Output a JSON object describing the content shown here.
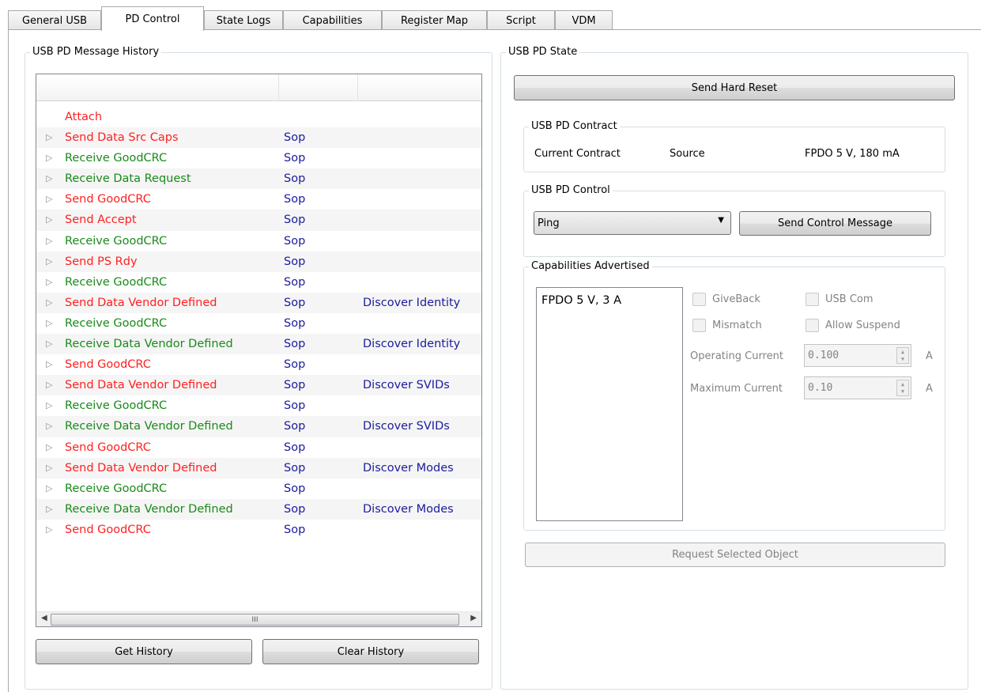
{
  "tabs": [
    "General USB",
    "PD Control",
    "State Logs",
    "Capabilities",
    "Register Map",
    "Script",
    "VDM"
  ],
  "active_tab": "PD Control",
  "history": {
    "title": "USB PD Message History",
    "rows": [
      {
        "msg": "Attach",
        "kind": "send",
        "sop": "",
        "vdm": "",
        "expandable": false
      },
      {
        "msg": "Send Data Src Caps",
        "kind": "send",
        "sop": "Sop",
        "vdm": "",
        "expandable": true
      },
      {
        "msg": "Receive GoodCRC",
        "kind": "recv",
        "sop": "Sop",
        "vdm": "",
        "expandable": true
      },
      {
        "msg": "Receive Data Request",
        "kind": "recv",
        "sop": "Sop",
        "vdm": "",
        "expandable": true
      },
      {
        "msg": "Send GoodCRC",
        "kind": "send",
        "sop": "Sop",
        "vdm": "",
        "expandable": true
      },
      {
        "msg": "Send Accept",
        "kind": "send",
        "sop": "Sop",
        "vdm": "",
        "expandable": true
      },
      {
        "msg": "Receive GoodCRC",
        "kind": "recv",
        "sop": "Sop",
        "vdm": "",
        "expandable": true
      },
      {
        "msg": "Send PS Rdy",
        "kind": "send",
        "sop": "Sop",
        "vdm": "",
        "expandable": true
      },
      {
        "msg": "Receive GoodCRC",
        "kind": "recv",
        "sop": "Sop",
        "vdm": "",
        "expandable": true
      },
      {
        "msg": "Send Data Vendor Defined",
        "kind": "send",
        "sop": "Sop",
        "vdm": "Discover Identity",
        "expandable": true
      },
      {
        "msg": "Receive GoodCRC",
        "kind": "recv",
        "sop": "Sop",
        "vdm": "",
        "expandable": true
      },
      {
        "msg": "Receive Data Vendor Defined",
        "kind": "recv",
        "sop": "Sop",
        "vdm": "Discover Identity",
        "expandable": true
      },
      {
        "msg": "Send GoodCRC",
        "kind": "send",
        "sop": "Sop",
        "vdm": "",
        "expandable": true
      },
      {
        "msg": "Send Data Vendor Defined",
        "kind": "send",
        "sop": "Sop",
        "vdm": "Discover SVIDs",
        "expandable": true
      },
      {
        "msg": "Receive GoodCRC",
        "kind": "recv",
        "sop": "Sop",
        "vdm": "",
        "expandable": true
      },
      {
        "msg": "Receive Data Vendor Defined",
        "kind": "recv",
        "sop": "Sop",
        "vdm": "Discover SVIDs",
        "expandable": true
      },
      {
        "msg": "Send GoodCRC",
        "kind": "send",
        "sop": "Sop",
        "vdm": "",
        "expandable": true
      },
      {
        "msg": "Send Data Vendor Defined",
        "kind": "send",
        "sop": "Sop",
        "vdm": "Discover Modes",
        "expandable": true
      },
      {
        "msg": "Receive GoodCRC",
        "kind": "recv",
        "sop": "Sop",
        "vdm": "",
        "expandable": true
      },
      {
        "msg": "Receive Data Vendor Defined",
        "kind": "recv",
        "sop": "Sop",
        "vdm": "Discover Modes",
        "expandable": true
      },
      {
        "msg": "Send GoodCRC",
        "kind": "send",
        "sop": "Sop",
        "vdm": "",
        "expandable": true
      }
    ],
    "scroll_grip": "III",
    "get_history_label": "Get History",
    "clear_history_label": "Clear History"
  },
  "state": {
    "title": "USB PD State",
    "hard_reset_label": "Send Hard Reset",
    "contract": {
      "title": "USB PD Contract",
      "label": "Current Contract",
      "role": "Source",
      "value": "FPDO 5 V, 180 mA"
    },
    "control": {
      "title": "USB PD Control",
      "selected": "Ping",
      "send_label": "Send Control Message"
    },
    "capabilities": {
      "title": "Capabilities Advertised",
      "items": [
        "FPDO 5 V, 3 A"
      ],
      "giveback_label": "GiveBack",
      "usbcom_label": "USB Com",
      "mismatch_label": "Mismatch",
      "allow_suspend_label": "Allow Suspend",
      "operating_current_label": "Operating Current",
      "operating_current_value": "0.100",
      "maximum_current_label": "Maximum Current",
      "maximum_current_value": "0.10",
      "unit": "A"
    },
    "request_label": "Request Selected Object"
  },
  "colors": {
    "send": "#ff2020",
    "recv": "#1a8a1a",
    "sop": "#1b1b9e"
  }
}
